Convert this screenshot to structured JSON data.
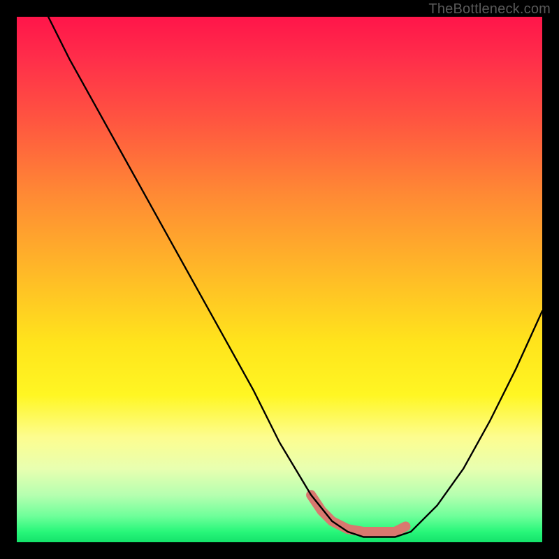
{
  "watermark": "TheBottleneck.com",
  "chart_data": {
    "type": "line",
    "title": "",
    "xlabel": "",
    "ylabel": "",
    "xlim": [
      0,
      100
    ],
    "ylim": [
      0,
      100
    ],
    "background_gradient": {
      "stops": [
        {
          "pos": 0.0,
          "color": "#ff154a"
        },
        {
          "pos": 0.08,
          "color": "#ff2e4a"
        },
        {
          "pos": 0.2,
          "color": "#ff5640"
        },
        {
          "pos": 0.34,
          "color": "#ff8a34"
        },
        {
          "pos": 0.48,
          "color": "#ffb728"
        },
        {
          "pos": 0.62,
          "color": "#ffe41c"
        },
        {
          "pos": 0.72,
          "color": "#fff623"
        },
        {
          "pos": 0.8,
          "color": "#fdfd8f"
        },
        {
          "pos": 0.86,
          "color": "#e8ffb0"
        },
        {
          "pos": 0.91,
          "color": "#b6ffb0"
        },
        {
          "pos": 0.95,
          "color": "#6fff9a"
        },
        {
          "pos": 0.98,
          "color": "#28f77a"
        },
        {
          "pos": 1.0,
          "color": "#14e26a"
        }
      ]
    },
    "series": [
      {
        "name": "bottleneck-curve",
        "color": "#000000",
        "stroke_width": 2,
        "x": [
          6,
          10,
          15,
          20,
          25,
          30,
          35,
          40,
          45,
          50,
          53,
          56,
          60,
          63,
          66,
          70,
          72,
          75,
          80,
          85,
          90,
          95,
          100
        ],
        "y": [
          100,
          92,
          83,
          74,
          65,
          56,
          47,
          38,
          29,
          19,
          14,
          9,
          4,
          2,
          1,
          1,
          1,
          2,
          7,
          14,
          23,
          33,
          44
        ]
      }
    ],
    "highlight_segment": {
      "name": "valley-highlight",
      "color": "#d9786f",
      "stroke_width": 9,
      "x": [
        56,
        58,
        60,
        63,
        66,
        70,
        72,
        74
      ],
      "y": [
        9,
        6,
        4,
        2.5,
        2,
        2,
        2,
        3
      ]
    }
  }
}
